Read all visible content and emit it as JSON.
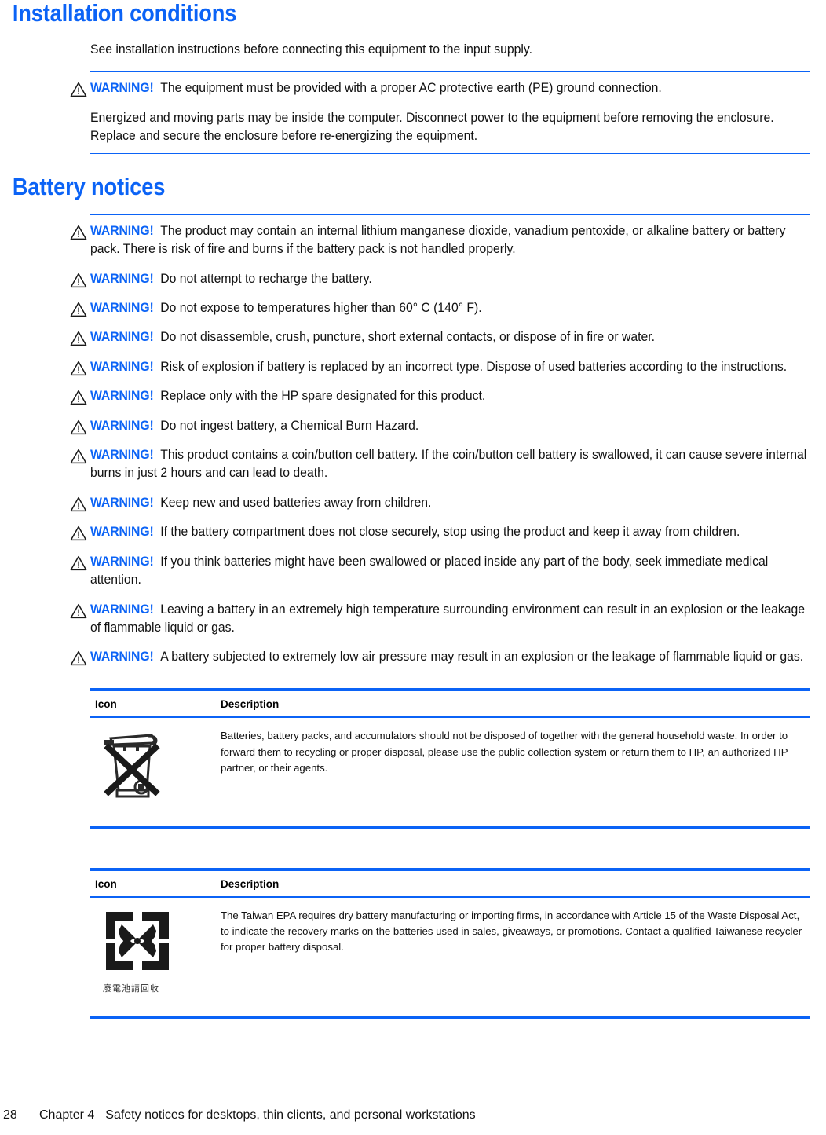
{
  "colors": {
    "accent_blue": "#0b63f6",
    "text": "#111111"
  },
  "sections": [
    {
      "id": "installation",
      "heading": "Installation conditions",
      "intro": "See installation instructions before connecting this equipment to the input supply.",
      "warnings": [
        {
          "label": "WARNING!",
          "text": "The equipment must be provided with a proper AC protective earth (PE) ground connection."
        }
      ],
      "followup": "Energized and moving parts may be inside the computer. Disconnect power to the equipment before removing the enclosure. Replace and secure the enclosure before re-energizing the equipment."
    },
    {
      "id": "battery",
      "heading": "Battery notices",
      "warnings": [
        {
          "label": "WARNING!",
          "text": "The product may contain an internal lithium manganese dioxide, vanadium pentoxide, or alkaline battery or battery pack. There is risk of fire and burns if the battery pack is not handled properly."
        },
        {
          "label": "WARNING!",
          "text": "Do not attempt to recharge the battery."
        },
        {
          "label": "WARNING!",
          "text": "Do not expose to temperatures higher than 60° C (140° F)."
        },
        {
          "label": "WARNING!",
          "text": "Do not disassemble, crush, puncture, short external contacts, or dispose of in fire or water."
        },
        {
          "label": "WARNING!",
          "text": "Risk of explosion if battery is replaced by an incorrect type. Dispose of used batteries according to the instructions."
        },
        {
          "label": "WARNING!",
          "text": "Replace only with the HP spare designated for this product."
        },
        {
          "label": "WARNING!",
          "text": "Do not ingest battery, a Chemical Burn Hazard."
        },
        {
          "label": "WARNING!",
          "text": "This product contains a coin/button cell battery. If the coin/button cell battery is swallowed, it can cause severe internal burns in just 2 hours and can lead to death."
        },
        {
          "label": "WARNING!",
          "text": "Keep new and used batteries away from children."
        },
        {
          "label": "WARNING!",
          "text": "If the battery compartment does not close securely, stop using the product and keep it away from children."
        },
        {
          "label": "WARNING!",
          "text": "If you think batteries might have been swallowed or placed inside any part of the body, seek immediate medical attention."
        },
        {
          "label": "WARNING!",
          "text": "Leaving a battery in an extremely high temperature surrounding environment can result in an explosion or the leakage of flammable liquid or gas."
        },
        {
          "label": "WARNING!",
          "text": "A battery subjected to extremely low air pressure may result in an explosion or the leakage of flammable liquid or gas."
        }
      ]
    }
  ],
  "tables": [
    {
      "id": "wheelie-bin-table",
      "headers": {
        "icon": "Icon",
        "description": "Description"
      },
      "row": {
        "icon_name": "crossed-out-wheeled-bin-icon",
        "description": "Batteries, battery packs, and accumulators should not be disposed of together with the general household waste. In order to forward them to recycling or proper disposal, please use the public collection system or return them to HP, an authorized HP partner, or their agents."
      }
    },
    {
      "id": "taiwan-epa-table",
      "headers": {
        "icon": "Icon",
        "description": "Description"
      },
      "row": {
        "icon_name": "taiwan-battery-recycling-icon",
        "icon_caption": "廢電池請回收",
        "description": "The Taiwan EPA requires dry battery manufacturing or importing firms, in accordance with Article 15 of the Waste Disposal Act, to indicate the recovery marks on the batteries used in sales, giveaways, or promotions. Contact a qualified Taiwanese recycler for proper battery disposal."
      }
    }
  ],
  "footer": {
    "page_number": "28",
    "chapter": "Chapter 4",
    "chapter_title": "Safety notices for desktops, thin clients, and personal workstations"
  }
}
